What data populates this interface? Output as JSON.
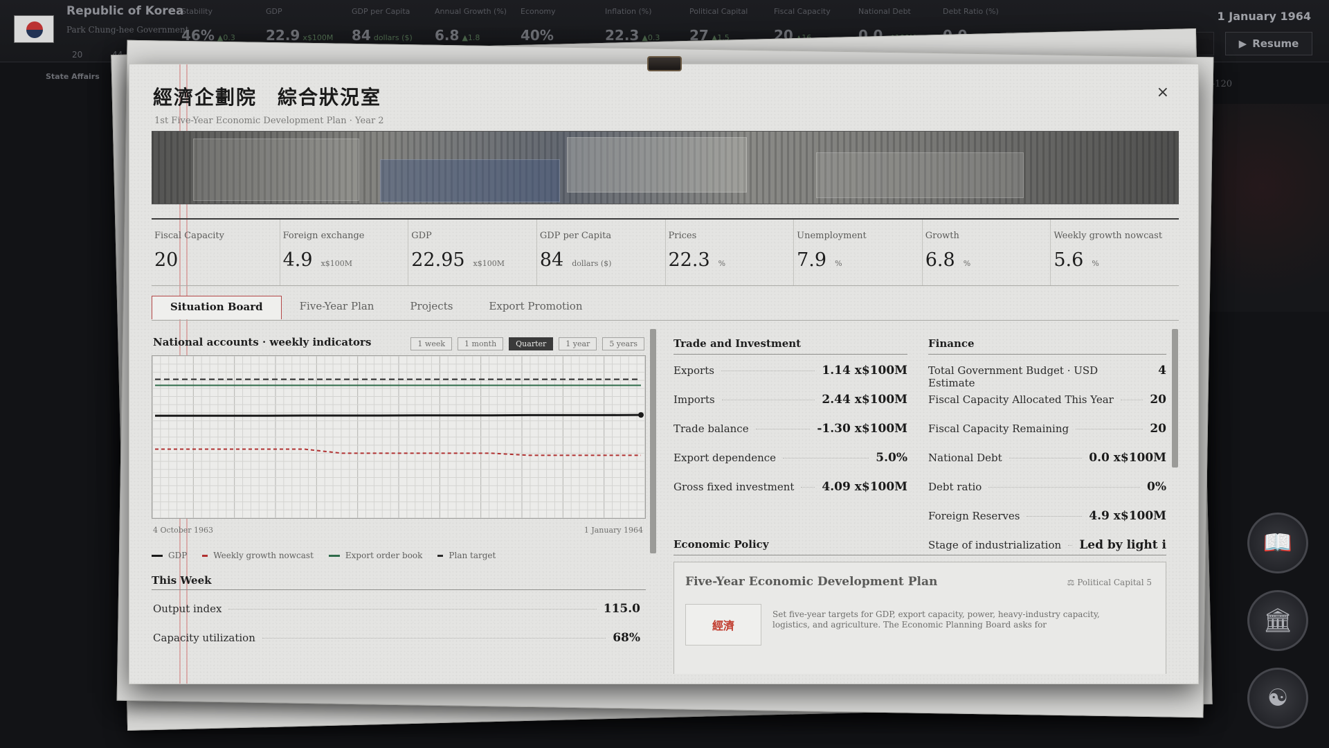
{
  "hud": {
    "country": "Republic of Korea",
    "government": "Park Chung-hee Government",
    "small_a": "20",
    "small_b": "44",
    "stats": [
      {
        "label": "Stability",
        "value": "46%",
        "delta": "▲0.3"
      },
      {
        "label": "GDP",
        "value": "22.9",
        "delta": "x$100M"
      },
      {
        "label": "GDP per Capita",
        "value": "84",
        "delta": "dollars ($)"
      },
      {
        "label": "Annual Growth (%)",
        "value": "6.8",
        "delta": "▲1.8"
      },
      {
        "label": "Economy",
        "value": "40%",
        "delta": ""
      },
      {
        "label": "Inflation (%)",
        "value": "22.3",
        "delta": "▲0.3"
      },
      {
        "label": "Political Capital",
        "value": "27",
        "delta": "▲1.5"
      },
      {
        "label": "Fiscal Capacity",
        "value": "20",
        "delta": "▲16"
      },
      {
        "label": "National Debt",
        "value": "0.0",
        "delta": "x$100M"
      },
      {
        "label": "Debt Ratio (%)",
        "value": "0.0",
        "delta": ""
      }
    ],
    "date": "1 January 1964",
    "resume_label": "Resume",
    "state_affairs": "State Affairs",
    "diplomatic_note": "Diplomatic note D-120"
  },
  "panel": {
    "title": "經濟企劃院　綜合狀況室",
    "subtitle": "1st Five-Year Economic Development Plan · Year 2",
    "close_label": "×"
  },
  "kpis": [
    {
      "label": "Fiscal Capacity",
      "value": "20",
      "unit": ""
    },
    {
      "label": "Foreign exchange",
      "value": "4.9",
      "unit": "x$100M"
    },
    {
      "label": "GDP",
      "value": "22.95",
      "unit": "x$100M"
    },
    {
      "label": "GDP per Capita",
      "value": "84",
      "unit": "dollars ($)"
    },
    {
      "label": "Prices",
      "value": "22.3",
      "unit": "%"
    },
    {
      "label": "Unemployment",
      "value": "7.9",
      "unit": "%"
    },
    {
      "label": "Growth",
      "value": "6.8",
      "unit": "%"
    },
    {
      "label": "Weekly growth nowcast",
      "value": "5.6",
      "unit": "%"
    }
  ],
  "tabs": [
    "Situation Board",
    "Five-Year Plan",
    "Projects",
    "Export Promotion"
  ],
  "chart_section": {
    "title": "National accounts · weekly indicators",
    "ranges": [
      "1 week",
      "1 month",
      "Quarter",
      "1 year",
      "5 years"
    ],
    "active_range": "Quarter",
    "start_date": "4 October 1963",
    "end_date": "1 January 1964"
  },
  "chart_data": {
    "type": "line",
    "x": [
      0,
      1,
      2,
      3,
      4,
      5,
      6,
      7,
      8,
      9,
      10,
      11,
      12,
      13
    ],
    "series": [
      {
        "name": "GDP",
        "color": "#1a1a1a",
        "dash": "solid",
        "values": [
          50.5,
          50.5,
          50.5,
          50.5,
          50.6,
          50.6,
          50.6,
          50.7,
          50.7,
          50.7,
          50.8,
          50.8,
          50.8,
          50.9
        ]
      },
      {
        "name": "Weekly growth nowcast",
        "color": "#b03030",
        "dash": "dashed",
        "values": [
          34,
          34,
          34,
          34,
          34,
          32,
          32,
          32,
          32,
          32,
          31,
          31,
          31,
          31
        ]
      },
      {
        "name": "Export order book",
        "color": "#2f6b4a",
        "dash": "solid",
        "values": [
          65.5,
          65.5,
          65.5,
          65.5,
          65.5,
          65.5,
          65.5,
          65.5,
          65.5,
          65.5,
          65.5,
          65.5,
          65.5,
          65.5
        ]
      },
      {
        "name": "Plan target",
        "color": "#2a2a2a",
        "dash": "dashed",
        "values": [
          68.5,
          68.5,
          68.5,
          68.5,
          68.5,
          68.5,
          68.5,
          68.5,
          68.5,
          68.5,
          68.5,
          68.5,
          68.5,
          68.5
        ]
      }
    ],
    "ylim": [
      0,
      80
    ],
    "grid": true,
    "legend": "bottom"
  },
  "this_week": {
    "title": "This Week",
    "rows": [
      {
        "label": "Output index",
        "value": "115.0"
      },
      {
        "label": "Capacity utilization",
        "value": "68%"
      }
    ]
  },
  "trade": {
    "title": "Trade and Investment",
    "rows": [
      {
        "label": "Exports",
        "value": "1.14 x$100M"
      },
      {
        "label": "Imports",
        "value": "2.44 x$100M"
      },
      {
        "label": "Trade balance",
        "value": "-1.30 x$100M"
      },
      {
        "label": "Export dependence",
        "value": "5.0%"
      },
      {
        "label": "Gross fixed investment",
        "value": "4.09 x$100M"
      }
    ]
  },
  "finance": {
    "title": "Finance",
    "rows": [
      {
        "label": "Total Government Budget · USD Estimate",
        "value": "4"
      },
      {
        "label": "Fiscal Capacity Allocated This Year",
        "value": "20"
      },
      {
        "label": "Fiscal Capacity Remaining",
        "value": "20"
      },
      {
        "label": "National Debt",
        "value": "0.0 x$100M"
      },
      {
        "label": "Debt ratio",
        "value": "0%"
      },
      {
        "label": "Foreign Reserves",
        "value": "4.9 x$100M"
      },
      {
        "label": "Stage of industrialization",
        "value": "Led by light i"
      }
    ]
  },
  "policy": {
    "title": "Economic Policy",
    "card_title": "Five-Year Economic Development Plan",
    "cost": "Political Capital 5",
    "seal": "經濟",
    "description": "Set five-year targets for GDP, export capacity, power, heavy-industry capacity, logistics, and agriculture. The Economic Planning Board asks for"
  }
}
